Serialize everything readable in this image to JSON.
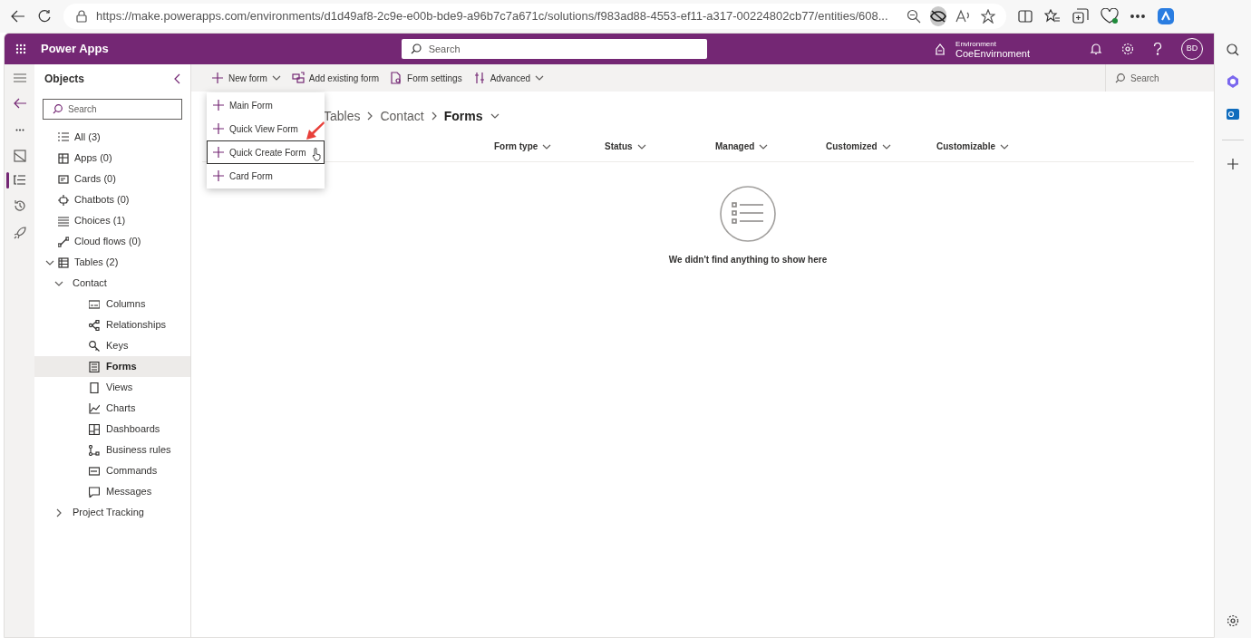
{
  "browser": {
    "url": "https://make.powerapps.com/environments/d1d49af8-2c9e-e00b-bde9-a96b7c7a671c/solutions/f983ad88-4553-ef11-a317-00224802cb77/entities/608..."
  },
  "app": {
    "title": "Power Apps",
    "search_placeholder": "Search",
    "environment_label": "Environment",
    "environment_name": "CoeEnvirnoment",
    "avatar": "BD"
  },
  "objects_pane": {
    "title": "Objects",
    "search_placeholder": "Search",
    "items": [
      {
        "label": "All (3)",
        "selected": false
      },
      {
        "label": "Apps (0)",
        "selected": false
      },
      {
        "label": "Cards (0)",
        "selected": false
      },
      {
        "label": "Chatbots (0)",
        "selected": false
      },
      {
        "label": "Choices (1)",
        "selected": false
      },
      {
        "label": "Cloud flows (0)",
        "selected": false
      },
      {
        "label": "Tables (2)",
        "selected": false,
        "expanded": true,
        "children": [
          {
            "label": "Contact",
            "selected": false,
            "expanded": true,
            "children": [
              {
                "label": "Columns",
                "selected": false
              },
              {
                "label": "Relationships",
                "selected": false
              },
              {
                "label": "Keys",
                "selected": false
              },
              {
                "label": "Forms",
                "selected": true
              },
              {
                "label": "Views",
                "selected": false
              },
              {
                "label": "Charts",
                "selected": false
              },
              {
                "label": "Dashboards",
                "selected": false
              },
              {
                "label": "Business rules",
                "selected": false
              },
              {
                "label": "Commands",
                "selected": false
              },
              {
                "label": "Messages",
                "selected": false
              }
            ]
          },
          {
            "label": "Project Tracking",
            "selected": false,
            "expanded": false
          }
        ]
      }
    ]
  },
  "command_bar": {
    "buttons": [
      {
        "label": "New form",
        "dropdown": true
      },
      {
        "label": "Add existing form",
        "dropdown": false
      },
      {
        "label": "Form settings",
        "dropdown": false
      },
      {
        "label": "Advanced",
        "dropdown": true
      }
    ],
    "search_placeholder": "Search"
  },
  "new_form_menu": {
    "items": [
      {
        "label": "Main Form",
        "selected": false
      },
      {
        "label": "Quick View Form",
        "selected": false
      },
      {
        "label": "Quick Create Form",
        "selected": true
      },
      {
        "label": "Card Form",
        "selected": false
      }
    ]
  },
  "breadcrumb": [
    {
      "label": "Tables",
      "current": false
    },
    {
      "label": "Contact",
      "current": false
    },
    {
      "label": "Forms",
      "current": true
    }
  ],
  "table": {
    "columns": [
      "Form type",
      "Status",
      "Managed",
      "Customized",
      "Customizable"
    ]
  },
  "empty_state": {
    "message": "We didn't find anything to show here"
  }
}
